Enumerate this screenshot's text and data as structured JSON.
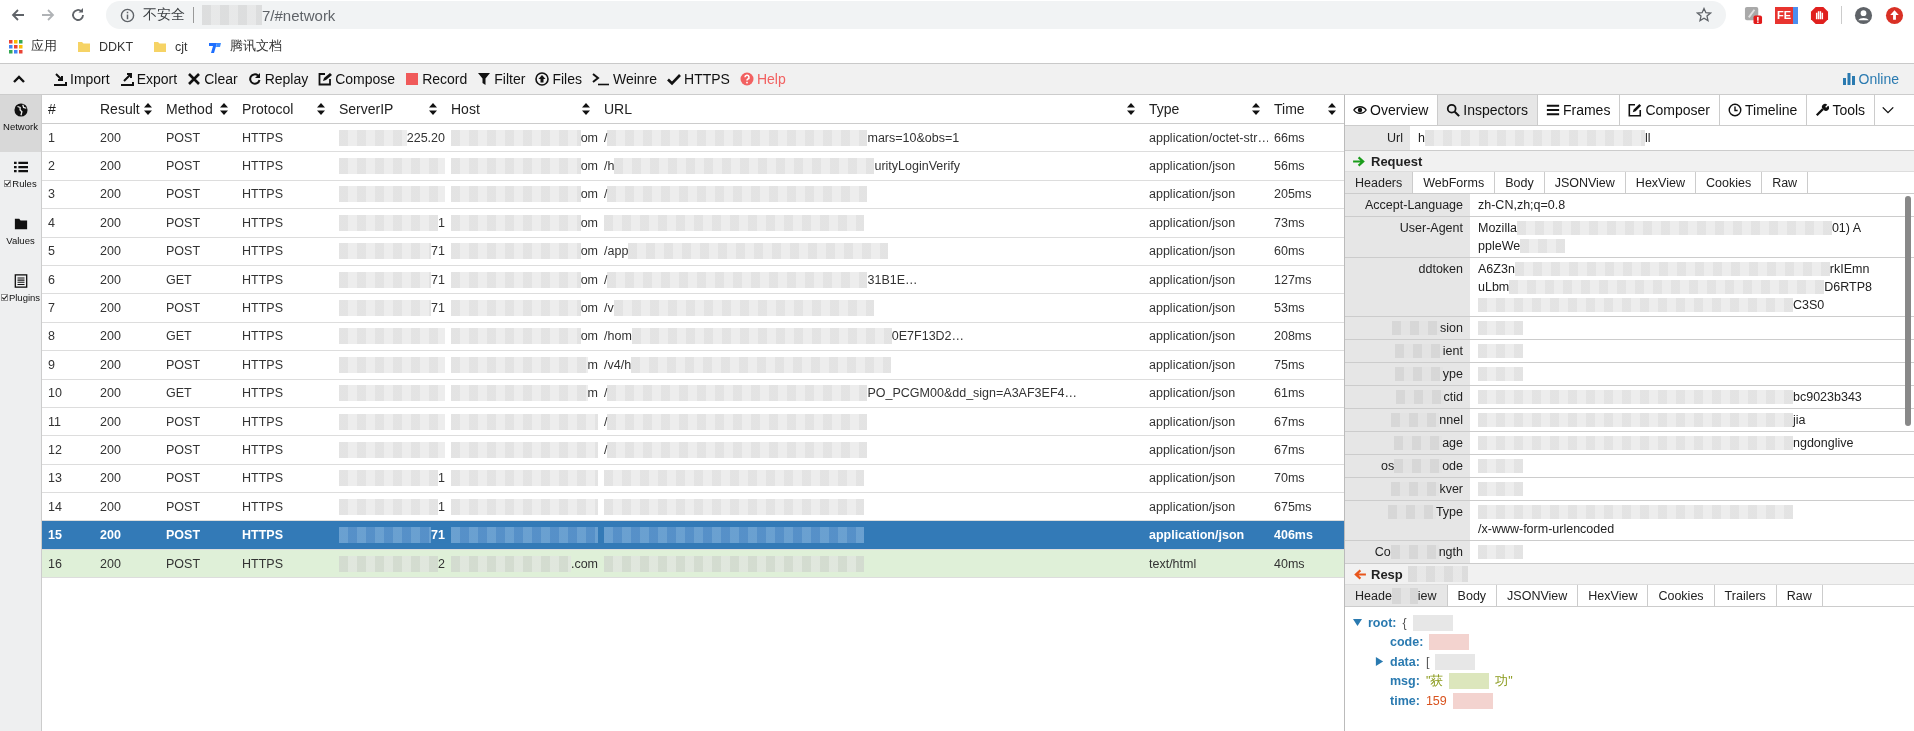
{
  "browser": {
    "security": "不安全",
    "address": [
      {
        "kind": "blur"
      },
      {
        "kind": "text",
        "text": "7/#network"
      }
    ],
    "extension_text": "FE",
    "bookmarks": [
      {
        "label": "应用",
        "kind": "apps"
      },
      {
        "label": "DDKT",
        "kind": "folder"
      },
      {
        "label": "cjt",
        "kind": "folder"
      },
      {
        "label": "腾讯文档",
        "kind": "docs"
      }
    ]
  },
  "toolbar": {
    "items": [
      {
        "label": "Import",
        "kind": "import"
      },
      {
        "label": "Export",
        "kind": "export"
      },
      {
        "label": "Clear",
        "kind": "clear"
      },
      {
        "label": "Replay",
        "kind": "replay"
      },
      {
        "label": "Compose",
        "kind": "compose"
      },
      {
        "label": "Record",
        "kind": "record"
      },
      {
        "label": "Filter",
        "kind": "filter"
      },
      {
        "label": "Files",
        "kind": "files"
      },
      {
        "label": "Weinre",
        "kind": "weinre"
      },
      {
        "label": "HTTPS",
        "kind": "https"
      },
      {
        "label": "Help",
        "kind": "help"
      }
    ],
    "online": "Online"
  },
  "sidebar": [
    {
      "label": "Network",
      "kind": "network",
      "selected": true
    },
    {
      "label": "Rules",
      "kind": "rules",
      "selected": false,
      "checked": true
    },
    {
      "label": "Values",
      "kind": "values",
      "selected": false
    },
    {
      "label": "Plugins",
      "kind": "plugins",
      "selected": false,
      "checked": true
    }
  ],
  "table": {
    "columns": [
      {
        "label": "#",
        "sortable": false
      },
      {
        "label": "Result",
        "sortable": true
      },
      {
        "label": "Method",
        "sortable": true
      },
      {
        "label": "Protocol",
        "sortable": true
      },
      {
        "label": "ServerIP",
        "sortable": true
      },
      {
        "label": "Host",
        "sortable": true
      },
      {
        "label": "URL",
        "sortable": true
      },
      {
        "label": "Type",
        "sortable": true
      },
      {
        "label": "Time",
        "sortable": true
      }
    ],
    "rows": [
      {
        "num": "1",
        "result": "200",
        "method": "POST",
        "protocol": "HTTPS",
        "server_ip": [
          {
            "kind": "blur"
          },
          {
            "kind": "text",
            "text": "225.20"
          }
        ],
        "host": [
          {
            "kind": "blur"
          },
          {
            "kind": "text",
            "text": "om"
          }
        ],
        "url": [
          {
            "kind": "text",
            "text": "/"
          },
          {
            "kind": "blur"
          },
          {
            "kind": "text",
            "text": "mars=10&obs=1"
          }
        ],
        "type": "application/octet-str…",
        "time": "66ms",
        "selected": false,
        "highlighted": false
      },
      {
        "num": "2",
        "result": "200",
        "method": "POST",
        "protocol": "HTTPS",
        "server_ip": [
          {
            "kind": "blur"
          }
        ],
        "host": [
          {
            "kind": "blur"
          },
          {
            "kind": "text",
            "text": "om"
          }
        ],
        "url": [
          {
            "kind": "text",
            "text": "/h"
          },
          {
            "kind": "blur"
          },
          {
            "kind": "text",
            "text": "urityLoginVerify"
          }
        ],
        "type": "application/json",
        "time": "56ms",
        "selected": false,
        "highlighted": false
      },
      {
        "num": "3",
        "result": "200",
        "method": "POST",
        "protocol": "HTTPS",
        "server_ip": [
          {
            "kind": "blur"
          }
        ],
        "host": [
          {
            "kind": "blur"
          },
          {
            "kind": "text",
            "text": "om"
          }
        ],
        "url": [
          {
            "kind": "text",
            "text": "/"
          },
          {
            "kind": "blur"
          }
        ],
        "type": "application/json",
        "time": "205ms",
        "selected": false,
        "highlighted": false
      },
      {
        "num": "4",
        "result": "200",
        "method": "POST",
        "protocol": "HTTPS",
        "server_ip": [
          {
            "kind": "blur"
          },
          {
            "kind": "text",
            "text": "1"
          }
        ],
        "host": [
          {
            "kind": "blur"
          },
          {
            "kind": "text",
            "text": "om"
          }
        ],
        "url": [
          {
            "kind": "blur"
          }
        ],
        "type": "application/json",
        "time": "73ms",
        "selected": false,
        "highlighted": false
      },
      {
        "num": "5",
        "result": "200",
        "method": "POST",
        "protocol": "HTTPS",
        "server_ip": [
          {
            "kind": "blur"
          },
          {
            "kind": "text",
            "text": "71"
          }
        ],
        "host": [
          {
            "kind": "blur"
          },
          {
            "kind": "text",
            "text": "om"
          }
        ],
        "url": [
          {
            "kind": "text",
            "text": "/app"
          },
          {
            "kind": "blur"
          }
        ],
        "type": "application/json",
        "time": "60ms",
        "selected": false,
        "highlighted": false
      },
      {
        "num": "6",
        "result": "200",
        "method": "GET",
        "protocol": "HTTPS",
        "server_ip": [
          {
            "kind": "blur"
          },
          {
            "kind": "text",
            "text": "71"
          }
        ],
        "host": [
          {
            "kind": "blur"
          },
          {
            "kind": "text",
            "text": "om"
          }
        ],
        "url": [
          {
            "kind": "text",
            "text": "/"
          },
          {
            "kind": "blur"
          },
          {
            "kind": "text",
            "text": "31B1E…"
          }
        ],
        "type": "application/json",
        "time": "127ms",
        "selected": false,
        "highlighted": false
      },
      {
        "num": "7",
        "result": "200",
        "method": "POST",
        "protocol": "HTTPS",
        "server_ip": [
          {
            "kind": "blur"
          },
          {
            "kind": "text",
            "text": "71"
          }
        ],
        "host": [
          {
            "kind": "blur"
          },
          {
            "kind": "text",
            "text": "om"
          }
        ],
        "url": [
          {
            "kind": "text",
            "text": "/v"
          },
          {
            "kind": "blur"
          }
        ],
        "type": "application/json",
        "time": "53ms",
        "selected": false,
        "highlighted": false
      },
      {
        "num": "8",
        "result": "200",
        "method": "GET",
        "protocol": "HTTPS",
        "server_ip": [
          {
            "kind": "blur"
          }
        ],
        "host": [
          {
            "kind": "blur"
          },
          {
            "kind": "text",
            "text": "om"
          }
        ],
        "url": [
          {
            "kind": "text",
            "text": "/hom"
          },
          {
            "kind": "blur"
          },
          {
            "kind": "text",
            "text": "0E7F13D2…"
          }
        ],
        "type": "application/json",
        "time": "208ms",
        "selected": false,
        "highlighted": false
      },
      {
        "num": "9",
        "result": "200",
        "method": "POST",
        "protocol": "HTTPS",
        "server_ip": [
          {
            "kind": "blur"
          }
        ],
        "host": [
          {
            "kind": "blur"
          },
          {
            "kind": "text",
            "text": "m"
          }
        ],
        "url": [
          {
            "kind": "text",
            "text": "/v4/h"
          },
          {
            "kind": "blur"
          }
        ],
        "type": "application/json",
        "time": "75ms",
        "selected": false,
        "highlighted": false
      },
      {
        "num": "10",
        "result": "200",
        "method": "GET",
        "protocol": "HTTPS",
        "server_ip": [
          {
            "kind": "blur"
          }
        ],
        "host": [
          {
            "kind": "blur"
          },
          {
            "kind": "text",
            "text": "m"
          }
        ],
        "url": [
          {
            "kind": "text",
            "text": "/"
          },
          {
            "kind": "blur"
          },
          {
            "kind": "text",
            "text": "PO_PCGM00&dd_sign=A3AF3EF4…"
          }
        ],
        "type": "application/json",
        "time": "61ms",
        "selected": false,
        "highlighted": false
      },
      {
        "num": "11",
        "result": "200",
        "method": "POST",
        "protocol": "HTTPS",
        "server_ip": [
          {
            "kind": "blur"
          }
        ],
        "host": [
          {
            "kind": "blur"
          }
        ],
        "url": [
          {
            "kind": "text",
            "text": "/"
          },
          {
            "kind": "blur"
          }
        ],
        "type": "application/json",
        "time": "67ms",
        "selected": false,
        "highlighted": false
      },
      {
        "num": "12",
        "result": "200",
        "method": "POST",
        "protocol": "HTTPS",
        "server_ip": [
          {
            "kind": "blur"
          }
        ],
        "host": [
          {
            "kind": "blur"
          }
        ],
        "url": [
          {
            "kind": "text",
            "text": "/"
          },
          {
            "kind": "blur"
          }
        ],
        "type": "application/json",
        "time": "67ms",
        "selected": false,
        "highlighted": false
      },
      {
        "num": "13",
        "result": "200",
        "method": "POST",
        "protocol": "HTTPS",
        "server_ip": [
          {
            "kind": "blur"
          },
          {
            "kind": "text",
            "text": "1"
          }
        ],
        "host": [
          {
            "kind": "blur"
          }
        ],
        "url": [
          {
            "kind": "blur"
          }
        ],
        "type": "application/json",
        "time": "70ms",
        "selected": false,
        "highlighted": false
      },
      {
        "num": "14",
        "result": "200",
        "method": "POST",
        "protocol": "HTTPS",
        "server_ip": [
          {
            "kind": "blur"
          },
          {
            "kind": "text",
            "text": "1"
          }
        ],
        "host": [
          {
            "kind": "blur"
          }
        ],
        "url": [
          {
            "kind": "blur"
          }
        ],
        "type": "application/json",
        "time": "675ms",
        "selected": false,
        "highlighted": false
      },
      {
        "num": "15",
        "result": "200",
        "method": "POST",
        "protocol": "HTTPS",
        "server_ip": [
          {
            "kind": "blur"
          },
          {
            "kind": "text",
            "text": "71"
          }
        ],
        "host": [
          {
            "kind": "blur"
          }
        ],
        "url": [
          {
            "kind": "blur"
          }
        ],
        "type": "application/json",
        "time": "406ms",
        "selected": true,
        "highlighted": false
      },
      {
        "num": "16",
        "result": "200",
        "method": "POST",
        "protocol": "HTTPS",
        "server_ip": [
          {
            "kind": "blur"
          },
          {
            "kind": "text",
            "text": "2"
          }
        ],
        "host": [
          {
            "kind": "blur"
          },
          {
            "kind": "text",
            "text": ".com"
          }
        ],
        "url": [
          {
            "kind": "blur"
          }
        ],
        "type": "text/html",
        "time": "40ms",
        "selected": false,
        "highlighted": true
      }
    ]
  },
  "inspector": {
    "tabs": [
      {
        "label": "Overview",
        "kind": "overview",
        "selected": false
      },
      {
        "label": "Inspectors",
        "kind": "inspectors",
        "selected": true
      },
      {
        "label": "Frames",
        "kind": "frames",
        "selected": false
      },
      {
        "label": "Composer",
        "kind": "composer",
        "selected": false
      },
      {
        "label": "Timeline",
        "kind": "timeline",
        "selected": false
      },
      {
        "label": "Tools",
        "kind": "tools",
        "selected": false
      }
    ],
    "url_label": "Url",
    "url_value": [
      {
        "kind": "text",
        "text": "h"
      },
      {
        "kind": "blur"
      },
      {
        "kind": "text",
        "text": "ll"
      }
    ],
    "request_title": [
      {
        "kind": "text",
        "text": "Request"
      }
    ],
    "request_tabs": [
      {
        "label": [
          {
            "kind": "text",
            "text": "Headers"
          }
        ],
        "selected": true
      },
      {
        "label": [
          {
            "kind": "text",
            "text": "WebForms"
          }
        ],
        "selected": false
      },
      {
        "label": [
          {
            "kind": "text",
            "text": "Body"
          }
        ],
        "selected": false
      },
      {
        "label": [
          {
            "kind": "text",
            "text": "JSONView"
          }
        ],
        "selected": false
      },
      {
        "label": [
          {
            "kind": "text",
            "text": "HexView"
          }
        ],
        "selected": false
      },
      {
        "label": [
          {
            "kind": "text",
            "text": "Cookies"
          }
        ],
        "selected": false
      },
      {
        "label": [
          {
            "kind": "text",
            "text": "Raw"
          }
        ],
        "selected": false
      }
    ],
    "headers": [
      {
        "name": [
          {
            "kind": "text",
            "text": "Accept-Language"
          }
        ],
        "value": [
          {
            "kind": "text",
            "text": "zh-CN,zh;q=0.8"
          }
        ]
      },
      {
        "name": [
          {
            "kind": "text",
            "text": "User-Agent"
          }
        ],
        "value": [
          {
            "kind": "text",
            "text": "Mozilla"
          },
          {
            "kind": "blur"
          },
          {
            "kind": "text",
            "text": "01) A"
          },
          {
            "kind": "text",
            "text": "ppleWe"
          },
          {
            "kind": "blur"
          }
        ]
      },
      {
        "name": [
          {
            "kind": "text",
            "text": "ddtoken"
          }
        ],
        "value": [
          {
            "kind": "text",
            "text": "A6Z3n"
          },
          {
            "kind": "blur"
          },
          {
            "kind": "text",
            "text": "rkIEmn"
          },
          {
            "kind": "text",
            "text": "uLbm"
          },
          {
            "kind": "blur"
          },
          {
            "kind": "text",
            "text": "D6RTP8"
          },
          {
            "kind": "blur"
          },
          {
            "kind": "text",
            "text": "C3S0"
          }
        ]
      },
      {
        "name": [
          {
            "kind": "blur"
          },
          {
            "kind": "text",
            "text": "sion"
          }
        ],
        "value": [
          {
            "kind": "blur"
          }
        ]
      },
      {
        "name": [
          {
            "kind": "blur"
          },
          {
            "kind": "text",
            "text": "ient"
          }
        ],
        "value": [
          {
            "kind": "blur"
          }
        ]
      },
      {
        "name": [
          {
            "kind": "blur"
          },
          {
            "kind": "text",
            "text": "ype"
          }
        ],
        "value": [
          {
            "kind": "blur"
          }
        ]
      },
      {
        "name": [
          {
            "kind": "blur"
          },
          {
            "kind": "text",
            "text": "ctid"
          }
        ],
        "value": [
          {
            "kind": "blur"
          },
          {
            "kind": "text",
            "text": "bc9023b343"
          }
        ]
      },
      {
        "name": [
          {
            "kind": "blur"
          },
          {
            "kind": "text",
            "text": "nnel"
          }
        ],
        "value": [
          {
            "kind": "blur"
          },
          {
            "kind": "text",
            "text": "jia"
          }
        ]
      },
      {
        "name": [
          {
            "kind": "blur"
          },
          {
            "kind": "text",
            "text": "age"
          }
        ],
        "value": [
          {
            "kind": "blur"
          },
          {
            "kind": "text",
            "text": "ngdonglive"
          }
        ]
      },
      {
        "name": [
          {
            "kind": "text",
            "text": "os"
          },
          {
            "kind": "blur"
          },
          {
            "kind": "text",
            "text": "ode"
          }
        ],
        "value": [
          {
            "kind": "blur"
          }
        ]
      },
      {
        "name": [
          {
            "kind": "blur"
          },
          {
            "kind": "text",
            "text": "kver"
          }
        ],
        "value": [
          {
            "kind": "blur"
          }
        ]
      },
      {
        "name": [
          {
            "kind": "blur"
          },
          {
            "kind": "text",
            "text": "Type"
          }
        ],
        "value": [
          {
            "kind": "blur"
          },
          {
            "kind": "text",
            "text": "/x-www-form-urlencoded"
          }
        ]
      },
      {
        "name": [
          {
            "kind": "text",
            "text": "Co"
          },
          {
            "kind": "blur"
          },
          {
            "kind": "text",
            "text": "ngth"
          }
        ],
        "value": [
          {
            "kind": "blur"
          }
        ]
      }
    ],
    "response_title": [
      {
        "kind": "text",
        "text": "Resp"
      },
      {
        "kind": "blur"
      }
    ],
    "response_tabs": [
      {
        "label": [
          {
            "kind": "text",
            "text": "Heade"
          },
          {
            "kind": "blur"
          },
          {
            "kind": "text",
            "text": "iew"
          }
        ],
        "selected": true
      },
      {
        "label": [
          {
            "kind": "text",
            "text": "Body"
          }
        ],
        "selected": false
      },
      {
        "label": [
          {
            "kind": "text",
            "text": "JSONView"
          }
        ],
        "selected": false
      },
      {
        "label": [
          {
            "kind": "text",
            "text": "HexView"
          }
        ],
        "selected": false
      },
      {
        "label": [
          {
            "kind": "text",
            "text": "Cookies"
          }
        ],
        "selected": false
      },
      {
        "label": [
          {
            "kind": "text",
            "text": "Trailers"
          }
        ],
        "selected": false
      },
      {
        "label": [
          {
            "kind": "text",
            "text": "Raw"
          }
        ],
        "selected": false
      }
    ],
    "tree": [
      {
        "key": "root:",
        "value": [
          {
            "kind": "text",
            "text": "{"
          },
          {
            "kind": "blur"
          }
        ],
        "kind": "object",
        "expanded": true,
        "children": [
          {
            "key": "code:",
            "value": [
              {
                "kind": "blur"
              }
            ],
            "kind": "number"
          },
          {
            "key": "data:",
            "value": [
              {
                "kind": "text",
                "text": "["
              },
              {
                "kind": "blur"
              }
            ],
            "kind": "object",
            "expanded": false
          },
          {
            "key": "msg:",
            "value": [
              {
                "kind": "text",
                "text": "\"获"
              },
              {
                "kind": "blur"
              },
              {
                "kind": "text",
                "text": "功\""
              }
            ],
            "kind": "string"
          },
          {
            "key": "time:",
            "value": [
              {
                "kind": "text",
                "text": "159"
              },
              {
                "kind": "blur"
              }
            ],
            "kind": "number"
          }
        ]
      }
    ]
  }
}
